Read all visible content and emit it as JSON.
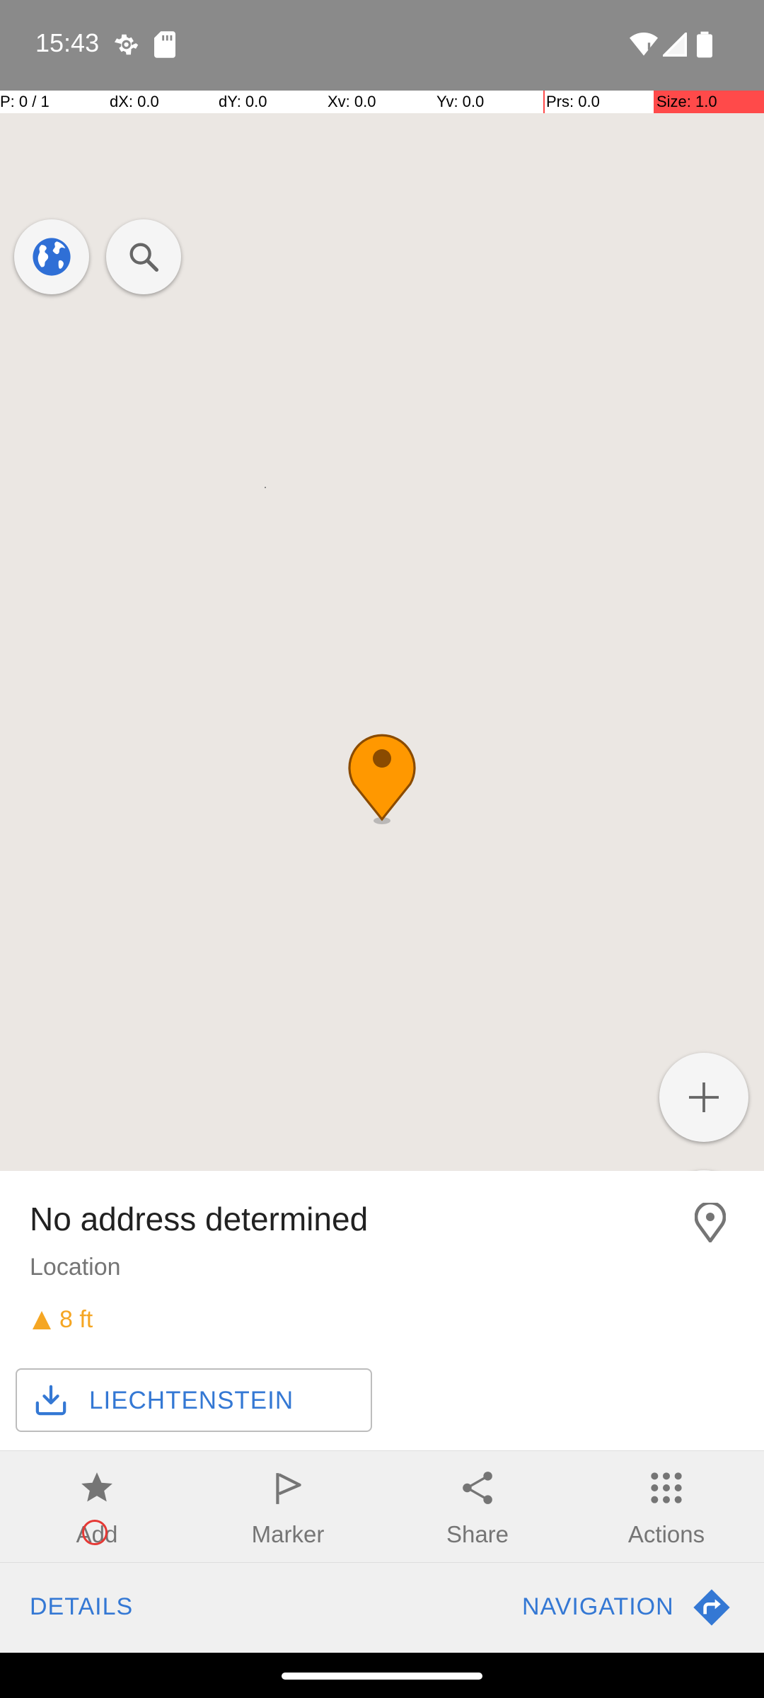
{
  "status_bar": {
    "time": "15:43",
    "icons": [
      "settings-gear-icon",
      "sd-card-icon",
      "wifi-alert-icon",
      "cell-signal-icon",
      "battery-full-icon"
    ]
  },
  "debug_overlay": {
    "pointer": "P: 0 / 1",
    "dx": "dX: 0.0",
    "dy": "dY: 0.0",
    "xv": "Xv: 0.0",
    "yv": "Yv: 0.0",
    "prs": "Prs: 0.0",
    "size": "Size: 1.0",
    "size_bg_color": "#ff4a4a"
  },
  "map": {
    "background_color": "#ebe7e3",
    "buttons": [
      "globe-icon",
      "search-icon",
      "zoom-in-icon",
      "zoom-out-icon"
    ],
    "marker_color": "#ff9800"
  },
  "place": {
    "address": "No address determined",
    "type": "Location",
    "distance": "8 ft",
    "distance_color": "#f5a623",
    "download_label": "LIECHTENSTEIN"
  },
  "actions": [
    {
      "label": "Add",
      "icon": "star-icon"
    },
    {
      "label": "Marker",
      "icon": "flag-icon"
    },
    {
      "label": "Share",
      "icon": "share-icon"
    },
    {
      "label": "Actions",
      "icon": "grid-dots-icon"
    }
  ],
  "bottom": {
    "details": "DETAILS",
    "navigation": "NAVIGATION",
    "accent_color": "#3478d4"
  }
}
